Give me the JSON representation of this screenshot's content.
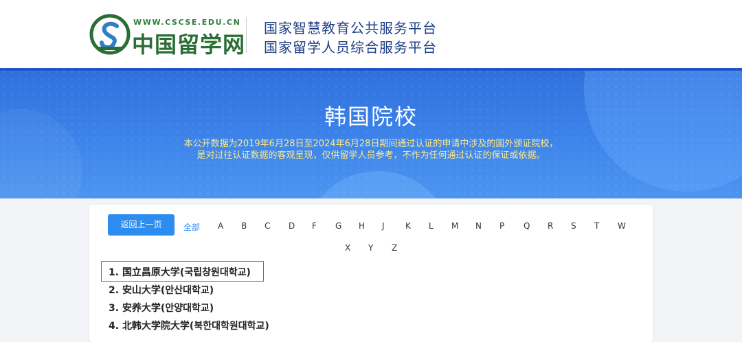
{
  "header": {
    "logo_url_text": "WWW.CSCSE.EDU.CN",
    "logo_name": "中国留学网",
    "platform_line_1": "国家智慧教育公共服务平台",
    "platform_line_2": "国家留学人员综合服务平台",
    "logo_color": "#2b6e35",
    "platform_color": "#1f3f87"
  },
  "banner": {
    "title": "韩国院校",
    "desc_line_1": "本公开数据为2019年6月28日至2024年6月28日期间通过认证的申请中涉及的国外颁证院校，",
    "desc_line_2": "是对过往认证数据的客观呈现，仅供留学人员参考，不作为任何通过认证的保证或依据。",
    "bg_color": "#3d84ea",
    "desc_color": "#ffe98a"
  },
  "filter": {
    "back_label": "返回上一页",
    "all_label": "全部",
    "letters_row_1": [
      "A",
      "B",
      "C",
      "D",
      "F",
      "G",
      "H",
      "J",
      "K",
      "L",
      "M",
      "N",
      "P",
      "Q",
      "R",
      "S",
      "T",
      "W"
    ],
    "letters_row_2": [
      "X",
      "Y",
      "Z"
    ],
    "accent_color": "#2d8cf0"
  },
  "schools": [
    {
      "index": "1.",
      "name": "国立昌原大学(국립창원대학교)",
      "highlighted": true
    },
    {
      "index": "2.",
      "name": "安山大学(안산대학교)",
      "highlighted": false
    },
    {
      "index": "3.",
      "name": "安养大学(안양대학교)",
      "highlighted": false
    },
    {
      "index": "4.",
      "name": "北韩大学院大学(북한대학원대학교)",
      "highlighted": false
    }
  ],
  "highlight_color": "#e0413a"
}
